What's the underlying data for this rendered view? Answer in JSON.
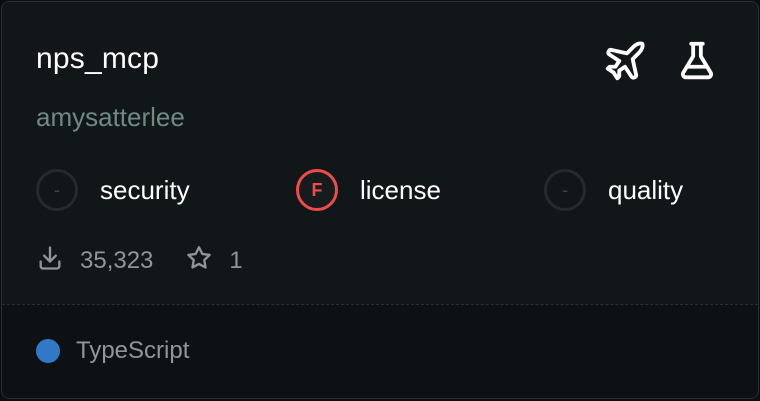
{
  "card": {
    "title": "nps_mcp",
    "author": "amysatterlee"
  },
  "top_icons": [
    {
      "icon": "airplane-icon"
    },
    {
      "icon": "flask-icon"
    }
  ],
  "scores": {
    "security": {
      "grade": "-",
      "label": "security"
    },
    "license": {
      "grade": "F",
      "label": "license"
    },
    "quality": {
      "grade": "-",
      "label": "quality"
    }
  },
  "stats": {
    "downloads": "35,323",
    "stars": "1",
    "downloads_icon": "download-icon",
    "stars_icon": "star-icon"
  },
  "footer": {
    "language": "TypeScript",
    "language_color": "#3178c6"
  },
  "colors": {
    "background": "#111618",
    "footer_background": "#0d1113",
    "author": "#6f8a83",
    "license_grade_ring": "#ef4b4b"
  }
}
